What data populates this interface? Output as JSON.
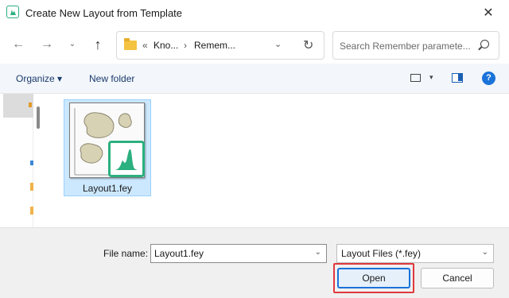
{
  "window": {
    "title": "Create New Layout from Template",
    "close_glyph": "✕",
    "app_icon": "peak-chart-icon",
    "accent_color": "#2bb07f"
  },
  "address": {
    "back_glyph": "←",
    "forward_glyph": "→",
    "recent_glyph": "⌄",
    "up_glyph": "↑",
    "prefix_glyph": "«",
    "crumbs": [
      "Kno...",
      "Remem..."
    ],
    "separator_glyph": "›",
    "dropdown_glyph": "⌄",
    "refresh_glyph": "↻",
    "search_placeholder": "Search Remember paramete..."
  },
  "toolbar": {
    "organize_label": "Organize ▾",
    "new_folder_label": "New folder",
    "view_drop_glyph": "▾",
    "help_glyph": "?"
  },
  "files": [
    {
      "name": "Layout1.fey",
      "selected": true,
      "icon": "layout-template-icon"
    }
  ],
  "footer": {
    "file_name_label": "File name:",
    "file_name_value": "Layout1.fey",
    "file_type_value": "Layout Files (*.fey)",
    "dropdown_glyph": "⌄",
    "open_label": "Open",
    "cancel_label": "Cancel",
    "highlight_color": "#e0393e"
  }
}
